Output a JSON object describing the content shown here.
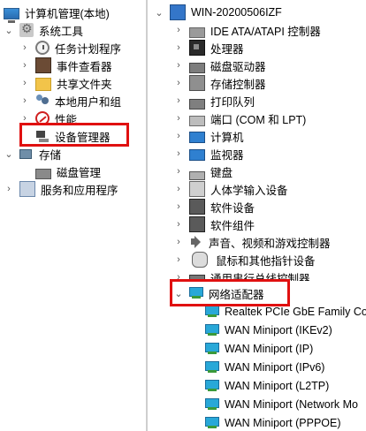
{
  "left_tree": {
    "root": {
      "label": "计算机管理(本地)"
    },
    "system_tools": {
      "label": "系统工具"
    },
    "task_scheduler": {
      "label": "任务计划程序"
    },
    "event_viewer": {
      "label": "事件查看器"
    },
    "shared_folders": {
      "label": "共享文件夹"
    },
    "local_users": {
      "label": "本地用户和组"
    },
    "performance": {
      "label": "性能"
    },
    "device_manager": {
      "label": "设备管理器"
    },
    "storage": {
      "label": "存储"
    },
    "disk_management": {
      "label": "磁盘管理"
    },
    "services": {
      "label": "服务和应用程序"
    }
  },
  "right_tree": {
    "computer_node": {
      "label": "WIN-20200506IZF"
    },
    "items": [
      {
        "label": "IDE ATA/ATAPI 控制器"
      },
      {
        "label": "处理器"
      },
      {
        "label": "磁盘驱动器"
      },
      {
        "label": "存储控制器"
      },
      {
        "label": "打印队列"
      },
      {
        "label": "端口 (COM 和 LPT)"
      },
      {
        "label": "计算机"
      },
      {
        "label": "监视器"
      },
      {
        "label": "键盘"
      },
      {
        "label": "人体学输入设备"
      },
      {
        "label": "软件设备"
      },
      {
        "label": "软件组件"
      },
      {
        "label": "声音、视频和游戏控制器"
      },
      {
        "label": "鼠标和其他指针设备"
      },
      {
        "label": "通用串行总线控制器"
      },
      {
        "label": "网络适配器"
      }
    ],
    "network_children": [
      {
        "label": "Realtek PCIe GbE Family Co"
      },
      {
        "label": "WAN Miniport (IKEv2)"
      },
      {
        "label": "WAN Miniport (IP)"
      },
      {
        "label": "WAN Miniport (IPv6)"
      },
      {
        "label": "WAN Miniport (L2TP)"
      },
      {
        "label": "WAN Miniport (Network Mo"
      },
      {
        "label": "WAN Miniport (PPPOE)"
      }
    ]
  },
  "expander_glyphs": {
    "collapsed": "›",
    "expanded": "⌄"
  }
}
